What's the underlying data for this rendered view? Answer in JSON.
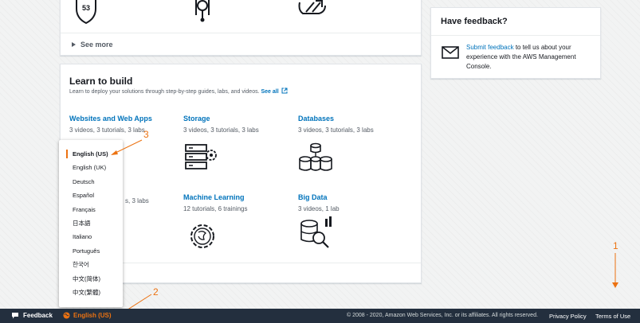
{
  "top_card": {
    "badge_number": "53",
    "see_more_label": "See more"
  },
  "learn": {
    "title": "Learn to build",
    "subtitle": "Learn to deploy your solutions through step-by-step guides, labs, and videos.",
    "see_all_label": "See all",
    "tiles": [
      {
        "title": "Websites and Web Apps",
        "desc": "3 videos, 3 tutorials, 3 labs"
      },
      {
        "title": "Storage",
        "desc": "3 videos, 3 tutorials, 3 labs"
      },
      {
        "title": "Databases",
        "desc": "3 videos, 3 tutorials, 3 labs"
      },
      {
        "title": "",
        "desc": "s, 3 labs"
      },
      {
        "title": "Machine Learning",
        "desc": "12 tutorials, 6 trainings"
      },
      {
        "title": "Big Data",
        "desc": "3 videos, 1 lab"
      }
    ]
  },
  "feedback": {
    "title": "Have feedback?",
    "link_label": "Submit feedback",
    "body": " to tell us about your experience with the AWS Management Console."
  },
  "language_menu": {
    "items": [
      {
        "label": "English (US)",
        "selected": true
      },
      {
        "label": "English (UK)"
      },
      {
        "label": "Deutsch"
      },
      {
        "label": "Español"
      },
      {
        "label": "Français"
      },
      {
        "label": "日本語"
      },
      {
        "label": "Italiano"
      },
      {
        "label": "Português"
      },
      {
        "label": "한국어"
      },
      {
        "label": "中文(简体)"
      },
      {
        "label": "中文(繁體)"
      }
    ]
  },
  "annotations": {
    "one": "1",
    "two": "2",
    "three": "3"
  },
  "footer": {
    "feedback_label": "Feedback",
    "language_label": "English (US)",
    "copyright": "© 2008 - 2020, Amazon Web Services, Inc. or its affiliates. All rights reserved.",
    "privacy_label": "Privacy Policy",
    "terms_label": "Terms of Use"
  },
  "colors": {
    "accent": "#ec7211",
    "link": "#0073bb",
    "footer_bg": "#232f3e"
  }
}
